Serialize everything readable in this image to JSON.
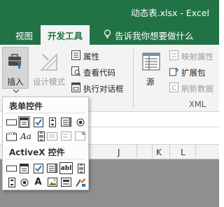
{
  "window": {
    "title": "动态表.xlsx  -  Excel"
  },
  "tabs": [
    {
      "label": "视图",
      "active": false
    },
    {
      "label": "开发工具",
      "active": true
    }
  ],
  "tell_me": {
    "text": "告诉我你想要做什么"
  },
  "ribbon": {
    "insert_label": "插入",
    "design_mode_label": "设计模式",
    "properties_label": "属性",
    "view_code_label": "查看代码",
    "run_dialog_label": "执行对话框",
    "source_label": "源",
    "map_properties_label": "映射属性",
    "expansion_pack_label": "扩展包",
    "refresh_data_label": "刷新数据",
    "xml_group_label": "XML"
  },
  "insert_menu": {
    "form_controls_title": "表单控件",
    "activex_title": "ActiveX 控件",
    "form_controls": [
      {
        "icon": "button-icon"
      },
      {
        "icon": "combo-box-icon",
        "selected": true
      },
      {
        "icon": "checkbox-icon"
      },
      {
        "icon": "spin-button-icon"
      },
      {
        "icon": "list-box-icon"
      },
      {
        "icon": "option-button-icon"
      },
      {
        "icon": "group-box-icon"
      },
      {
        "icon": "label-icon",
        "text": "Aa"
      },
      {
        "icon": "scroll-bar-icon"
      },
      {
        "icon": "text-field-icon"
      },
      {
        "icon": "combo-list-edit-icon"
      },
      {
        "icon": "combo-drop-down-edit-icon"
      }
    ],
    "activex_controls": [
      {
        "icon": "command-button-icon"
      },
      {
        "icon": "combo-box-icon"
      },
      {
        "icon": "checkbox-icon"
      },
      {
        "icon": "list-box-icon"
      },
      {
        "icon": "text-box-icon",
        "text": "abl"
      },
      {
        "icon": "scroll-bar-icon"
      },
      {
        "icon": "spin-button-icon"
      },
      {
        "icon": "option-button-icon"
      },
      {
        "icon": "label-icon",
        "text": "A"
      },
      {
        "icon": "image-icon"
      },
      {
        "icon": "toggle-button-icon"
      },
      {
        "icon": "more-controls-icon"
      }
    ]
  },
  "sheet": {
    "columns": [
      "J",
      "K",
      "L"
    ]
  },
  "colors": {
    "accent": "#217346",
    "ribbon_bg": "#f3f3f3",
    "grid_bg": "#8f8f8f"
  }
}
